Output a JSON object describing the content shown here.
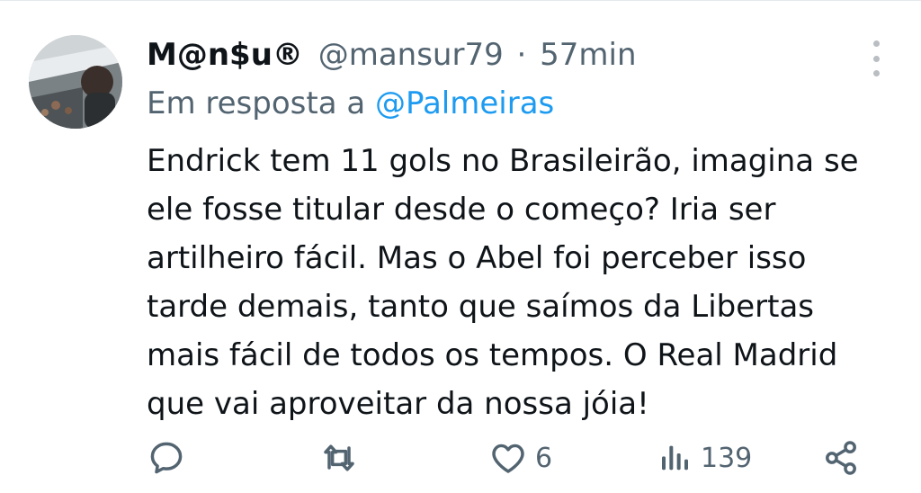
{
  "tweet": {
    "display_name": "M@n$u®",
    "handle": "@mansur79",
    "separator": "·",
    "time": "57min",
    "reply_prefix": "Em resposta a",
    "reply_to": "@Palmeiras",
    "text_lines": [
      "Endrick tem 11 gols no Brasileirão, imagina se",
      "ele fosse titular desde o começo? Iria ser",
      "artilheiro fácil. Mas o Abel foi perceber isso",
      "tarde demais, tanto que saímos da Libertas",
      "mais fácil de todos os tempos. O Real Madrid",
      "que vai aproveitar da nossa jóia!"
    ]
  },
  "actions": {
    "reply_count": "",
    "retweet_count": "",
    "like_count": "6",
    "views_count": "139"
  },
  "icons": {
    "reply": "comment-icon",
    "retweet": "retweet-icon",
    "like": "heart-icon",
    "views": "views-chart-icon",
    "share": "share-icon",
    "more": "more-vertical-icon"
  },
  "colors": {
    "text": "#0f1419",
    "secondary": "#536471",
    "link": "#1d9bf0"
  }
}
